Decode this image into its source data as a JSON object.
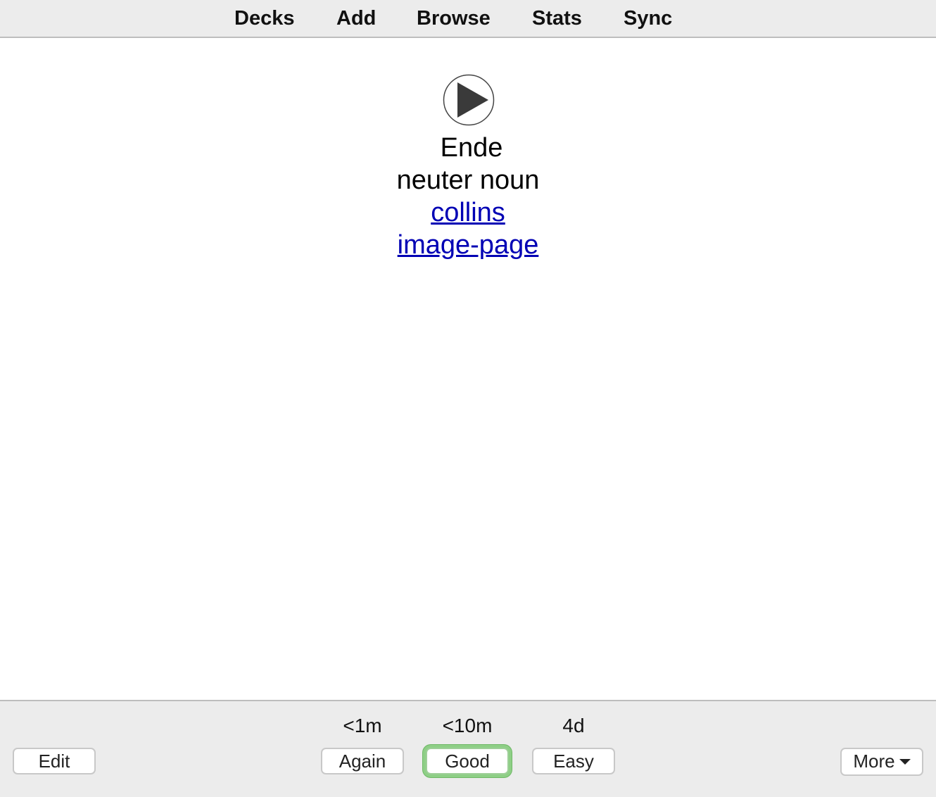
{
  "nav": {
    "decks": "Decks",
    "add": "Add",
    "browse": "Browse",
    "stats": "Stats",
    "sync": "Sync"
  },
  "card": {
    "play_icon": "play-audio-icon",
    "word": "Ende",
    "grammar": "neuter noun",
    "link_collins": "collins",
    "link_image_page": "image-page",
    "link_color": "#0000b4"
  },
  "answer_bar": {
    "edit_label": "Edit",
    "again": {
      "interval": "<1m",
      "label": "Again"
    },
    "good": {
      "interval": "<10m",
      "label": "Good",
      "focus_color": "#8ecf86"
    },
    "easy": {
      "interval": "4d",
      "label": "Easy"
    },
    "more_label": "More",
    "more_icon": "caret-down-icon"
  }
}
